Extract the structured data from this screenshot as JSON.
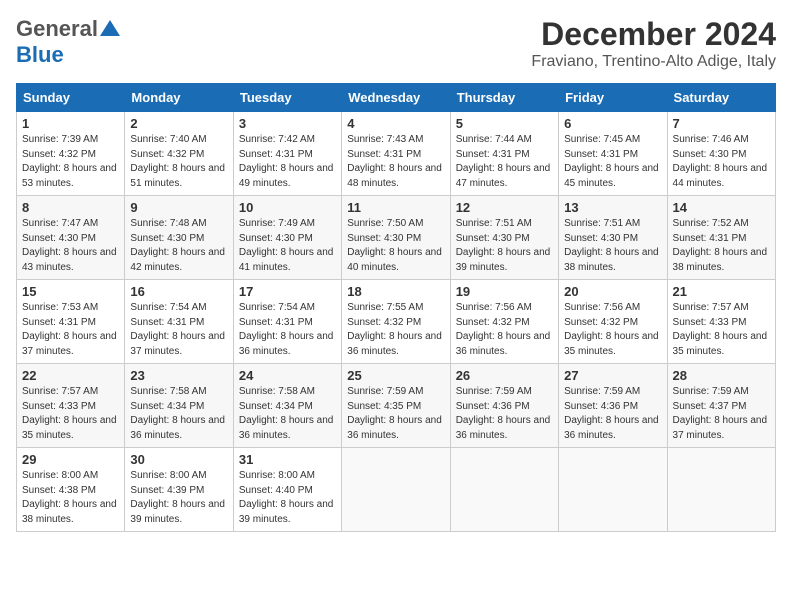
{
  "header": {
    "logo_top": "General",
    "logo_bottom": "Blue",
    "title": "December 2024",
    "subtitle": "Fraviano, Trentino-Alto Adige, Italy"
  },
  "calendar": {
    "days_of_week": [
      "Sunday",
      "Monday",
      "Tuesday",
      "Wednesday",
      "Thursday",
      "Friday",
      "Saturday"
    ],
    "weeks": [
      [
        null,
        null,
        null,
        null,
        null,
        null,
        null
      ]
    ]
  },
  "cells": {
    "w1": [
      {
        "day": "1",
        "sunrise": "Sunrise: 7:39 AM",
        "sunset": "Sunset: 4:32 PM",
        "daylight": "Daylight: 8 hours and 53 minutes."
      },
      {
        "day": "2",
        "sunrise": "Sunrise: 7:40 AM",
        "sunset": "Sunset: 4:32 PM",
        "daylight": "Daylight: 8 hours and 51 minutes."
      },
      {
        "day": "3",
        "sunrise": "Sunrise: 7:42 AM",
        "sunset": "Sunset: 4:31 PM",
        "daylight": "Daylight: 8 hours and 49 minutes."
      },
      {
        "day": "4",
        "sunrise": "Sunrise: 7:43 AM",
        "sunset": "Sunset: 4:31 PM",
        "daylight": "Daylight: 8 hours and 48 minutes."
      },
      {
        "day": "5",
        "sunrise": "Sunrise: 7:44 AM",
        "sunset": "Sunset: 4:31 PM",
        "daylight": "Daylight: 8 hours and 47 minutes."
      },
      {
        "day": "6",
        "sunrise": "Sunrise: 7:45 AM",
        "sunset": "Sunset: 4:31 PM",
        "daylight": "Daylight: 8 hours and 45 minutes."
      },
      {
        "day": "7",
        "sunrise": "Sunrise: 7:46 AM",
        "sunset": "Sunset: 4:30 PM",
        "daylight": "Daylight: 8 hours and 44 minutes."
      }
    ],
    "w2": [
      {
        "day": "8",
        "sunrise": "Sunrise: 7:47 AM",
        "sunset": "Sunset: 4:30 PM",
        "daylight": "Daylight: 8 hours and 43 minutes."
      },
      {
        "day": "9",
        "sunrise": "Sunrise: 7:48 AM",
        "sunset": "Sunset: 4:30 PM",
        "daylight": "Daylight: 8 hours and 42 minutes."
      },
      {
        "day": "10",
        "sunrise": "Sunrise: 7:49 AM",
        "sunset": "Sunset: 4:30 PM",
        "daylight": "Daylight: 8 hours and 41 minutes."
      },
      {
        "day": "11",
        "sunrise": "Sunrise: 7:50 AM",
        "sunset": "Sunset: 4:30 PM",
        "daylight": "Daylight: 8 hours and 40 minutes."
      },
      {
        "day": "12",
        "sunrise": "Sunrise: 7:51 AM",
        "sunset": "Sunset: 4:30 PM",
        "daylight": "Daylight: 8 hours and 39 minutes."
      },
      {
        "day": "13",
        "sunrise": "Sunrise: 7:51 AM",
        "sunset": "Sunset: 4:30 PM",
        "daylight": "Daylight: 8 hours and 38 minutes."
      },
      {
        "day": "14",
        "sunrise": "Sunrise: 7:52 AM",
        "sunset": "Sunset: 4:31 PM",
        "daylight": "Daylight: 8 hours and 38 minutes."
      }
    ],
    "w3": [
      {
        "day": "15",
        "sunrise": "Sunrise: 7:53 AM",
        "sunset": "Sunset: 4:31 PM",
        "daylight": "Daylight: 8 hours and 37 minutes."
      },
      {
        "day": "16",
        "sunrise": "Sunrise: 7:54 AM",
        "sunset": "Sunset: 4:31 PM",
        "daylight": "Daylight: 8 hours and 37 minutes."
      },
      {
        "day": "17",
        "sunrise": "Sunrise: 7:54 AM",
        "sunset": "Sunset: 4:31 PM",
        "daylight": "Daylight: 8 hours and 36 minutes."
      },
      {
        "day": "18",
        "sunrise": "Sunrise: 7:55 AM",
        "sunset": "Sunset: 4:32 PM",
        "daylight": "Daylight: 8 hours and 36 minutes."
      },
      {
        "day": "19",
        "sunrise": "Sunrise: 7:56 AM",
        "sunset": "Sunset: 4:32 PM",
        "daylight": "Daylight: 8 hours and 36 minutes."
      },
      {
        "day": "20",
        "sunrise": "Sunrise: 7:56 AM",
        "sunset": "Sunset: 4:32 PM",
        "daylight": "Daylight: 8 hours and 35 minutes."
      },
      {
        "day": "21",
        "sunrise": "Sunrise: 7:57 AM",
        "sunset": "Sunset: 4:33 PM",
        "daylight": "Daylight: 8 hours and 35 minutes."
      }
    ],
    "w4": [
      {
        "day": "22",
        "sunrise": "Sunrise: 7:57 AM",
        "sunset": "Sunset: 4:33 PM",
        "daylight": "Daylight: 8 hours and 35 minutes."
      },
      {
        "day": "23",
        "sunrise": "Sunrise: 7:58 AM",
        "sunset": "Sunset: 4:34 PM",
        "daylight": "Daylight: 8 hours and 36 minutes."
      },
      {
        "day": "24",
        "sunrise": "Sunrise: 7:58 AM",
        "sunset": "Sunset: 4:34 PM",
        "daylight": "Daylight: 8 hours and 36 minutes."
      },
      {
        "day": "25",
        "sunrise": "Sunrise: 7:59 AM",
        "sunset": "Sunset: 4:35 PM",
        "daylight": "Daylight: 8 hours and 36 minutes."
      },
      {
        "day": "26",
        "sunrise": "Sunrise: 7:59 AM",
        "sunset": "Sunset: 4:36 PM",
        "daylight": "Daylight: 8 hours and 36 minutes."
      },
      {
        "day": "27",
        "sunrise": "Sunrise: 7:59 AM",
        "sunset": "Sunset: 4:36 PM",
        "daylight": "Daylight: 8 hours and 36 minutes."
      },
      {
        "day": "28",
        "sunrise": "Sunrise: 7:59 AM",
        "sunset": "Sunset: 4:37 PM",
        "daylight": "Daylight: 8 hours and 37 minutes."
      }
    ],
    "w5": [
      {
        "day": "29",
        "sunrise": "Sunrise: 8:00 AM",
        "sunset": "Sunset: 4:38 PM",
        "daylight": "Daylight: 8 hours and 38 minutes."
      },
      {
        "day": "30",
        "sunrise": "Sunrise: 8:00 AM",
        "sunset": "Sunset: 4:39 PM",
        "daylight": "Daylight: 8 hours and 39 minutes."
      },
      {
        "day": "31",
        "sunrise": "Sunrise: 8:00 AM",
        "sunset": "Sunset: 4:40 PM",
        "daylight": "Daylight: 8 hours and 39 minutes."
      },
      null,
      null,
      null,
      null
    ]
  }
}
